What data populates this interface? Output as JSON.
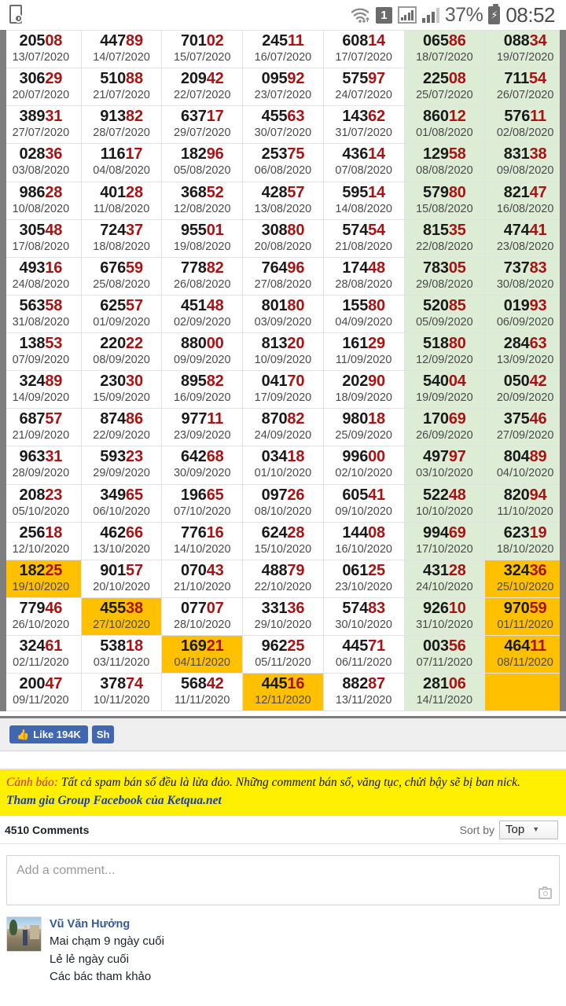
{
  "statusbar": {
    "icons": {
      "screen_record": "screen-clock-icon",
      "wifi": "wifi-icon",
      "sim": "1",
      "signal_boxed": "signal-boxed-icon",
      "signal": "signal-bars-icon",
      "battery": "battery-charging-icon"
    },
    "battery_percent": "37%",
    "time": "08:52"
  },
  "colors": {
    "weekend_bg": "#dcecd5",
    "highlight_bg": "#ffc000",
    "number_main": "#1a1a1a",
    "number_tail": "#a81414",
    "warning_bg": "#ffef00",
    "warning_lead": "#cf2b2b",
    "warning_link": "#1d3fa8",
    "facebook_blue": "#4267b2",
    "scrollbar": "#7e7e7e"
  },
  "table": {
    "name": "lottery-results-calendar",
    "columns": 7,
    "rows": [
      [
        {
          "head": "205",
          "tail": "08",
          "date": "13/07/2020",
          "state": "normal"
        },
        {
          "head": "447",
          "tail": "89",
          "date": "14/07/2020",
          "state": "normal"
        },
        {
          "head": "701",
          "tail": "02",
          "date": "15/07/2020",
          "state": "normal"
        },
        {
          "head": "245",
          "tail": "11",
          "date": "16/07/2020",
          "state": "normal"
        },
        {
          "head": "608",
          "tail": "14",
          "date": "17/07/2020",
          "state": "normal"
        },
        {
          "head": "065",
          "tail": "86",
          "date": "18/07/2020",
          "state": "weekend"
        },
        {
          "head": "088",
          "tail": "34",
          "date": "19/07/2020",
          "state": "weekend"
        }
      ],
      [
        {
          "head": "306",
          "tail": "29",
          "date": "20/07/2020",
          "state": "normal"
        },
        {
          "head": "510",
          "tail": "88",
          "date": "21/07/2020",
          "state": "normal"
        },
        {
          "head": "209",
          "tail": "42",
          "date": "22/07/2020",
          "state": "normal"
        },
        {
          "head": "095",
          "tail": "92",
          "date": "23/07/2020",
          "state": "normal"
        },
        {
          "head": "575",
          "tail": "97",
          "date": "24/07/2020",
          "state": "normal"
        },
        {
          "head": "225",
          "tail": "08",
          "date": "25/07/2020",
          "state": "weekend"
        },
        {
          "head": "711",
          "tail": "54",
          "date": "26/07/2020",
          "state": "weekend"
        }
      ],
      [
        {
          "head": "389",
          "tail": "31",
          "date": "27/07/2020",
          "state": "normal"
        },
        {
          "head": "913",
          "tail": "82",
          "date": "28/07/2020",
          "state": "normal"
        },
        {
          "head": "637",
          "tail": "17",
          "date": "29/07/2020",
          "state": "normal"
        },
        {
          "head": "455",
          "tail": "63",
          "date": "30/07/2020",
          "state": "normal"
        },
        {
          "head": "143",
          "tail": "62",
          "date": "31/07/2020",
          "state": "normal"
        },
        {
          "head": "860",
          "tail": "12",
          "date": "01/08/2020",
          "state": "weekend"
        },
        {
          "head": "576",
          "tail": "11",
          "date": "02/08/2020",
          "state": "weekend"
        }
      ],
      [
        {
          "head": "028",
          "tail": "36",
          "date": "03/08/2020",
          "state": "normal"
        },
        {
          "head": "116",
          "tail": "17",
          "date": "04/08/2020",
          "state": "normal"
        },
        {
          "head": "182",
          "tail": "96",
          "date": "05/08/2020",
          "state": "normal"
        },
        {
          "head": "253",
          "tail": "75",
          "date": "06/08/2020",
          "state": "normal"
        },
        {
          "head": "436",
          "tail": "14",
          "date": "07/08/2020",
          "state": "normal"
        },
        {
          "head": "129",
          "tail": "58",
          "date": "08/08/2020",
          "state": "weekend"
        },
        {
          "head": "831",
          "tail": "38",
          "date": "09/08/2020",
          "state": "weekend"
        }
      ],
      [
        {
          "head": "986",
          "tail": "28",
          "date": "10/08/2020",
          "state": "normal"
        },
        {
          "head": "401",
          "tail": "28",
          "date": "11/08/2020",
          "state": "normal"
        },
        {
          "head": "368",
          "tail": "52",
          "date": "12/08/2020",
          "state": "normal"
        },
        {
          "head": "428",
          "tail": "57",
          "date": "13/08/2020",
          "state": "normal"
        },
        {
          "head": "595",
          "tail": "14",
          "date": "14/08/2020",
          "state": "normal"
        },
        {
          "head": "579",
          "tail": "80",
          "date": "15/08/2020",
          "state": "weekend"
        },
        {
          "head": "821",
          "tail": "47",
          "date": "16/08/2020",
          "state": "weekend"
        }
      ],
      [
        {
          "head": "305",
          "tail": "48",
          "date": "17/08/2020",
          "state": "normal"
        },
        {
          "head": "724",
          "tail": "37",
          "date": "18/08/2020",
          "state": "normal"
        },
        {
          "head": "955",
          "tail": "01",
          "date": "19/08/2020",
          "state": "normal"
        },
        {
          "head": "308",
          "tail": "80",
          "date": "20/08/2020",
          "state": "normal"
        },
        {
          "head": "574",
          "tail": "54",
          "date": "21/08/2020",
          "state": "normal"
        },
        {
          "head": "815",
          "tail": "35",
          "date": "22/08/2020",
          "state": "weekend"
        },
        {
          "head": "474",
          "tail": "41",
          "date": "23/08/2020",
          "state": "weekend"
        }
      ],
      [
        {
          "head": "493",
          "tail": "16",
          "date": "24/08/2020",
          "state": "normal"
        },
        {
          "head": "676",
          "tail": "59",
          "date": "25/08/2020",
          "state": "normal"
        },
        {
          "head": "778",
          "tail": "82",
          "date": "26/08/2020",
          "state": "normal"
        },
        {
          "head": "764",
          "tail": "96",
          "date": "27/08/2020",
          "state": "normal"
        },
        {
          "head": "174",
          "tail": "48",
          "date": "28/08/2020",
          "state": "normal"
        },
        {
          "head": "783",
          "tail": "05",
          "date": "29/08/2020",
          "state": "weekend"
        },
        {
          "head": "737",
          "tail": "83",
          "date": "30/08/2020",
          "state": "weekend"
        }
      ],
      [
        {
          "head": "563",
          "tail": "58",
          "date": "31/08/2020",
          "state": "normal"
        },
        {
          "head": "625",
          "tail": "57",
          "date": "01/09/2020",
          "state": "normal"
        },
        {
          "head": "451",
          "tail": "48",
          "date": "02/09/2020",
          "state": "normal"
        },
        {
          "head": "801",
          "tail": "80",
          "date": "03/09/2020",
          "state": "normal"
        },
        {
          "head": "155",
          "tail": "80",
          "date": "04/09/2020",
          "state": "normal"
        },
        {
          "head": "520",
          "tail": "85",
          "date": "05/09/2020",
          "state": "weekend"
        },
        {
          "head": "019",
          "tail": "93",
          "date": "06/09/2020",
          "state": "weekend"
        }
      ],
      [
        {
          "head": "138",
          "tail": "53",
          "date": "07/09/2020",
          "state": "normal"
        },
        {
          "head": "220",
          "tail": "22",
          "date": "08/09/2020",
          "state": "normal"
        },
        {
          "head": "880",
          "tail": "00",
          "date": "09/09/2020",
          "state": "normal"
        },
        {
          "head": "813",
          "tail": "20",
          "date": "10/09/2020",
          "state": "normal"
        },
        {
          "head": "161",
          "tail": "29",
          "date": "11/09/2020",
          "state": "normal"
        },
        {
          "head": "518",
          "tail": "80",
          "date": "12/09/2020",
          "state": "weekend"
        },
        {
          "head": "284",
          "tail": "63",
          "date": "13/09/2020",
          "state": "weekend"
        }
      ],
      [
        {
          "head": "324",
          "tail": "89",
          "date": "14/09/2020",
          "state": "normal"
        },
        {
          "head": "230",
          "tail": "30",
          "date": "15/09/2020",
          "state": "normal"
        },
        {
          "head": "895",
          "tail": "82",
          "date": "16/09/2020",
          "state": "normal"
        },
        {
          "head": "041",
          "tail": "70",
          "date": "17/09/2020",
          "state": "normal"
        },
        {
          "head": "202",
          "tail": "90",
          "date": "18/09/2020",
          "state": "normal"
        },
        {
          "head": "540",
          "tail": "04",
          "date": "19/09/2020",
          "state": "weekend"
        },
        {
          "head": "050",
          "tail": "42",
          "date": "20/09/2020",
          "state": "weekend"
        }
      ],
      [
        {
          "head": "687",
          "tail": "57",
          "date": "21/09/2020",
          "state": "normal"
        },
        {
          "head": "874",
          "tail": "86",
          "date": "22/09/2020",
          "state": "normal"
        },
        {
          "head": "977",
          "tail": "11",
          "date": "23/09/2020",
          "state": "normal"
        },
        {
          "head": "870",
          "tail": "82",
          "date": "24/09/2020",
          "state": "normal"
        },
        {
          "head": "980",
          "tail": "18",
          "date": "25/09/2020",
          "state": "normal"
        },
        {
          "head": "170",
          "tail": "69",
          "date": "26/09/2020",
          "state": "weekend"
        },
        {
          "head": "375",
          "tail": "46",
          "date": "27/09/2020",
          "state": "weekend"
        }
      ],
      [
        {
          "head": "963",
          "tail": "31",
          "date": "28/09/2020",
          "state": "normal"
        },
        {
          "head": "593",
          "tail": "23",
          "date": "29/09/2020",
          "state": "normal"
        },
        {
          "head": "642",
          "tail": "68",
          "date": "30/09/2020",
          "state": "normal"
        },
        {
          "head": "034",
          "tail": "18",
          "date": "01/10/2020",
          "state": "normal"
        },
        {
          "head": "996",
          "tail": "00",
          "date": "02/10/2020",
          "state": "normal"
        },
        {
          "head": "497",
          "tail": "97",
          "date": "03/10/2020",
          "state": "weekend"
        },
        {
          "head": "804",
          "tail": "89",
          "date": "04/10/2020",
          "state": "weekend"
        }
      ],
      [
        {
          "head": "208",
          "tail": "23",
          "date": "05/10/2020",
          "state": "normal"
        },
        {
          "head": "349",
          "tail": "65",
          "date": "06/10/2020",
          "state": "normal"
        },
        {
          "head": "196",
          "tail": "65",
          "date": "07/10/2020",
          "state": "normal"
        },
        {
          "head": "097",
          "tail": "26",
          "date": "08/10/2020",
          "state": "normal"
        },
        {
          "head": "605",
          "tail": "41",
          "date": "09/10/2020",
          "state": "normal"
        },
        {
          "head": "522",
          "tail": "48",
          "date": "10/10/2020",
          "state": "weekend"
        },
        {
          "head": "820",
          "tail": "94",
          "date": "11/10/2020",
          "state": "weekend"
        }
      ],
      [
        {
          "head": "256",
          "tail": "18",
          "date": "12/10/2020",
          "state": "normal"
        },
        {
          "head": "462",
          "tail": "66",
          "date": "13/10/2020",
          "state": "normal"
        },
        {
          "head": "776",
          "tail": "16",
          "date": "14/10/2020",
          "state": "normal"
        },
        {
          "head": "624",
          "tail": "28",
          "date": "15/10/2020",
          "state": "normal"
        },
        {
          "head": "144",
          "tail": "08",
          "date": "16/10/2020",
          "state": "normal"
        },
        {
          "head": "994",
          "tail": "69",
          "date": "17/10/2020",
          "state": "weekend"
        },
        {
          "head": "623",
          "tail": "19",
          "date": "18/10/2020",
          "state": "weekend"
        }
      ],
      [
        {
          "head": "182",
          "tail": "25",
          "date": "19/10/2020",
          "state": "highlight"
        },
        {
          "head": "901",
          "tail": "57",
          "date": "20/10/2020",
          "state": "normal"
        },
        {
          "head": "070",
          "tail": "43",
          "date": "21/10/2020",
          "state": "normal"
        },
        {
          "head": "488",
          "tail": "79",
          "date": "22/10/2020",
          "state": "normal"
        },
        {
          "head": "061",
          "tail": "25",
          "date": "23/10/2020",
          "state": "normal"
        },
        {
          "head": "431",
          "tail": "28",
          "date": "24/10/2020",
          "state": "weekend"
        },
        {
          "head": "324",
          "tail": "36",
          "date": "25/10/2020",
          "state": "highlight"
        }
      ],
      [
        {
          "head": "779",
          "tail": "46",
          "date": "26/10/2020",
          "state": "normal"
        },
        {
          "head": "455",
          "tail": "38",
          "date": "27/10/2020",
          "state": "highlight"
        },
        {
          "head": "077",
          "tail": "07",
          "date": "28/10/2020",
          "state": "normal"
        },
        {
          "head": "331",
          "tail": "36",
          "date": "29/10/2020",
          "state": "normal"
        },
        {
          "head": "574",
          "tail": "83",
          "date": "30/10/2020",
          "state": "normal"
        },
        {
          "head": "926",
          "tail": "10",
          "date": "31/10/2020",
          "state": "weekend"
        },
        {
          "head": "970",
          "tail": "59",
          "date": "01/11/2020",
          "state": "highlight"
        }
      ],
      [
        {
          "head": "324",
          "tail": "61",
          "date": "02/11/2020",
          "state": "normal"
        },
        {
          "head": "538",
          "tail": "18",
          "date": "03/11/2020",
          "state": "normal"
        },
        {
          "head": "169",
          "tail": "21",
          "date": "04/11/2020",
          "state": "highlight"
        },
        {
          "head": "962",
          "tail": "25",
          "date": "05/11/2020",
          "state": "normal"
        },
        {
          "head": "445",
          "tail": "71",
          "date": "06/11/2020",
          "state": "normal"
        },
        {
          "head": "003",
          "tail": "56",
          "date": "07/11/2020",
          "state": "weekend"
        },
        {
          "head": "464",
          "tail": "11",
          "date": "08/11/2020",
          "state": "highlight"
        }
      ],
      [
        {
          "head": "200",
          "tail": "47",
          "date": "09/11/2020",
          "state": "normal"
        },
        {
          "head": "378",
          "tail": "74",
          "date": "10/11/2020",
          "state": "normal"
        },
        {
          "head": "568",
          "tail": "42",
          "date": "11/11/2020",
          "state": "normal"
        },
        {
          "head": "445",
          "tail": "16",
          "date": "12/11/2020",
          "state": "highlight"
        },
        {
          "head": "882",
          "tail": "87",
          "date": "13/11/2020",
          "state": "normal"
        },
        {
          "head": "281",
          "tail": "06",
          "date": "14/11/2020",
          "state": "weekend"
        },
        {
          "head": "",
          "tail": "",
          "date": "",
          "state": "highlight"
        }
      ]
    ]
  },
  "facebook": {
    "like_label": "Like 194K",
    "like_count": "194K",
    "share_label": "Sh",
    "thumb_icon": "thumbs-up-icon"
  },
  "warning": {
    "lead": "Cảnh báo:",
    "text": " Tất cả spam bán số đều là lừa đảo. Những comment bán số, văng tục, chửi bậy sẽ bị ban nick.",
    "link": "Tham gia Group Facebook của Ketqua.net"
  },
  "comments": {
    "count_label": "4510 Comments",
    "sort_label": "Sort by",
    "sort_value": "Top",
    "composer_placeholder": "Add a comment...",
    "camera_icon": "camera-icon",
    "list": [
      {
        "author": "Vũ Văn Hưởng",
        "lines": [
          "Mai chạm 9 ngày cuối",
          "Lẻ lẻ ngày cuối",
          "Các bác tham khảo"
        ]
      }
    ]
  }
}
